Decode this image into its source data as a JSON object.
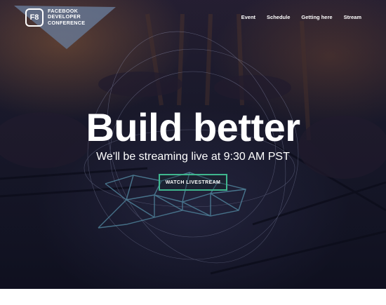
{
  "logo": {
    "badge": "F8",
    "lines": [
      "FACEBOOK",
      "DEVELOPER",
      "CONFERENCE"
    ]
  },
  "nav": {
    "items": [
      {
        "label": "Event"
      },
      {
        "label": "Schedule"
      },
      {
        "label": "Getting here"
      },
      {
        "label": "Stream"
      }
    ]
  },
  "hero": {
    "headline": "Build better",
    "subhead": "We'll be streaming live at 9:30 AM PST",
    "cta_label": "WATCH LIVESTREAM"
  },
  "colors": {
    "accent": "#3fb68e",
    "text": "#ffffff",
    "background": "#1b1b2a",
    "banner": "#8aa6c8"
  }
}
